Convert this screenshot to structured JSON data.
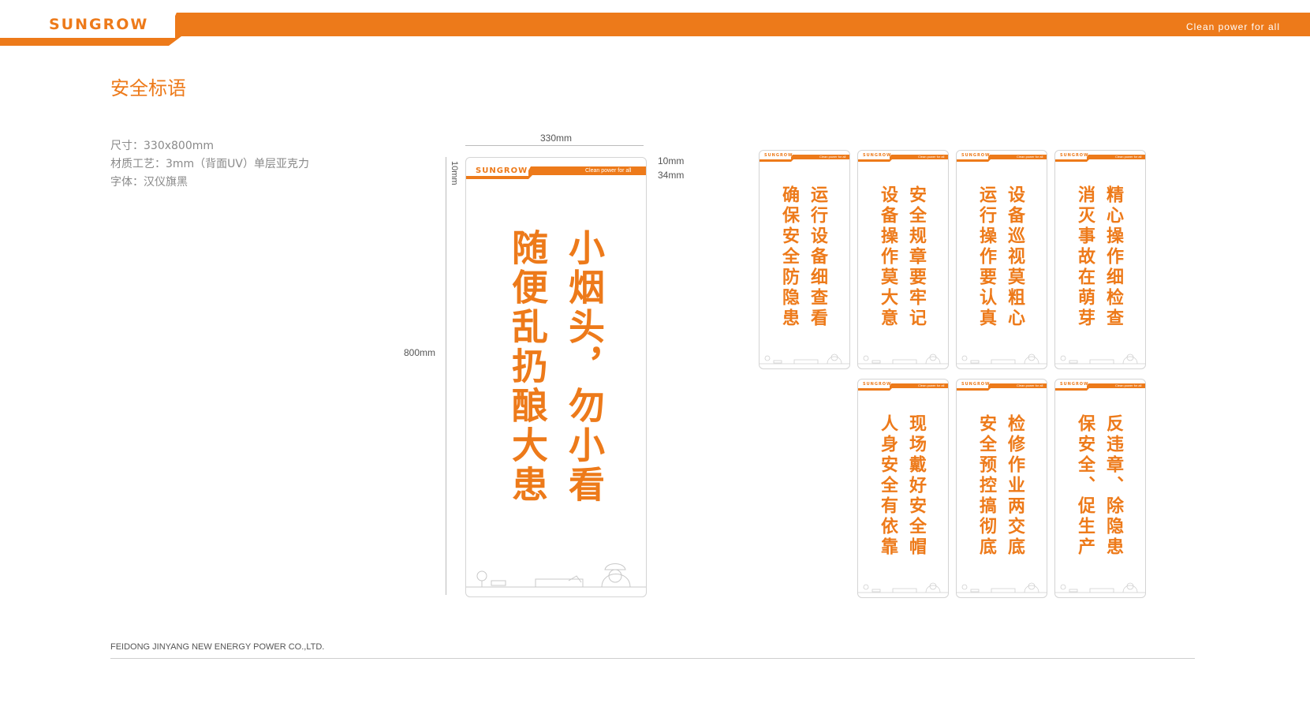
{
  "header": {
    "brand": "SUNGROW",
    "tagline": "Clean power for all",
    "accent": "#ED7A1A"
  },
  "section_title": "安全标语",
  "specs": [
    "尺寸：330x800mm",
    "材质工艺：3mm（背面UV）单层亚克力",
    "字体：汉仪旗黑"
  ],
  "dimensions": {
    "width": "330mm",
    "height": "800mm",
    "top_margin": "10mm",
    "top_band": "10mm",
    "band_height": "34mm"
  },
  "main_sign": {
    "brand": "SUNGROW",
    "tagline": "Clean power for all",
    "col_right": "小烟头，勿小看",
    "col_left": "随便乱扔酿大患"
  },
  "small_signs": [
    {
      "col_right": "运行设备细查看",
      "col_left": "确保安全防隐患"
    },
    {
      "col_right": "安全规章要牢记",
      "col_left": "设备操作莫大意"
    },
    {
      "col_right": "设备巡视莫粗心",
      "col_left": "运行操作要认真"
    },
    {
      "col_right": "精心操作细检查",
      "col_left": "消灭事故在萌芽"
    },
    {
      "col_right": "现场戴好安全帽",
      "col_left": "人身安全有依靠"
    },
    {
      "col_right": "检修作业两交底",
      "col_left": "安全预控搞彻底"
    },
    {
      "col_right": "反违章、除隐患",
      "col_left": "保安全、促生产"
    }
  ],
  "small_sign_brand": "SUNGROW",
  "small_sign_tagline": "Clean power for all",
  "footer": {
    "company": "FEIDONG JINYANG NEW ENERGY POWER CO.,LTD."
  }
}
